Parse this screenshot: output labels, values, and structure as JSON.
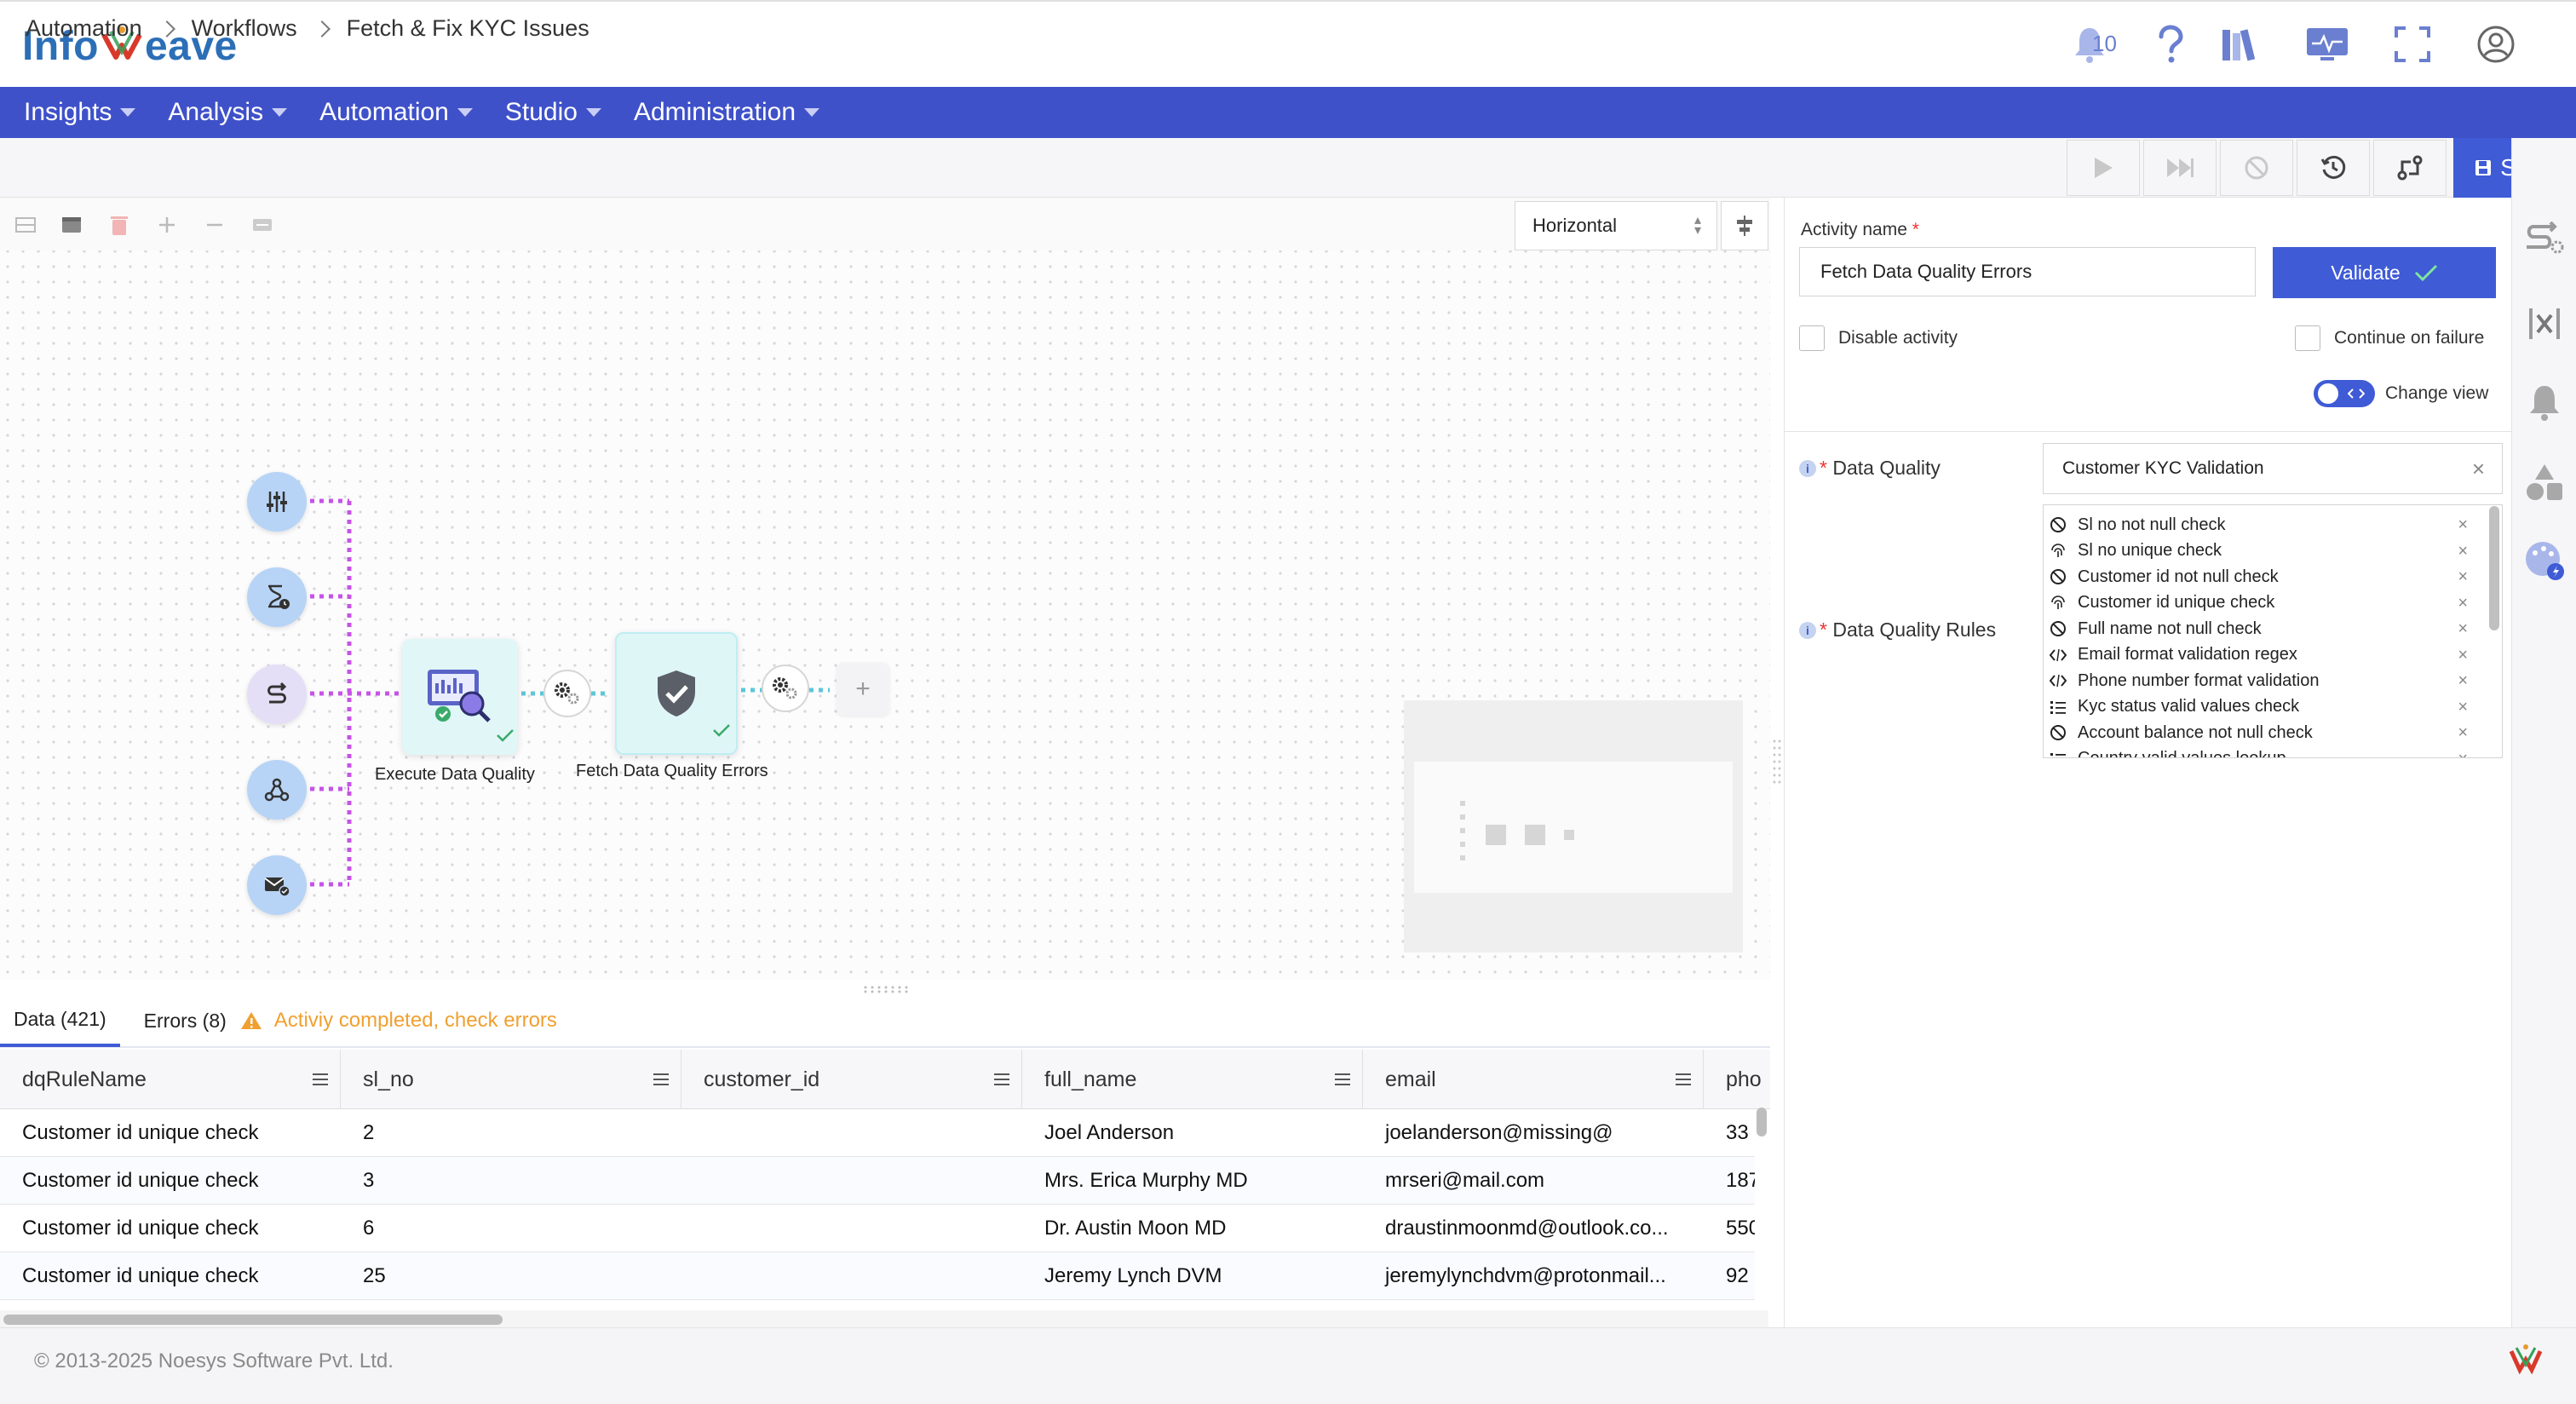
{
  "header": {
    "logo_prefix": "Info",
    "logo_suffix": "eave",
    "notification_count": "10"
  },
  "nav": {
    "items": [
      {
        "label": "Insights"
      },
      {
        "label": "Analysis"
      },
      {
        "label": "Automation"
      },
      {
        "label": "Studio"
      },
      {
        "label": "Administration"
      }
    ]
  },
  "breadcrumb": {
    "items": [
      "Automation",
      "Workflows",
      "Fetch & Fix KYC Issues"
    ]
  },
  "toolbar": {
    "save_label": "Save"
  },
  "canvas": {
    "orientation": "Horizontal",
    "nodes": [
      {
        "label": "Execute Data Quality"
      },
      {
        "label": "Fetch Data Quality Errors"
      }
    ],
    "add_symbol": "+"
  },
  "data_panel": {
    "tabs": [
      {
        "label": "Data (421)"
      },
      {
        "label": "Errors (8)"
      }
    ],
    "status_message": "Activiy completed, check errors",
    "columns": [
      "dqRuleName",
      "sl_no",
      "customer_id",
      "full_name",
      "email",
      "pho"
    ],
    "rows": [
      [
        "Customer id unique check",
        "2",
        "",
        "Joel Anderson",
        "joelanderson@missing@",
        "33"
      ],
      [
        "Customer id unique check",
        "3",
        "",
        "Mrs. Erica Murphy MD",
        "mrseri@mail.com",
        "187"
      ],
      [
        "Customer id unique check",
        "6",
        "",
        "Dr. Austin Moon MD",
        "draustinmoonmd@outlook.co...",
        "550"
      ],
      [
        "Customer id unique check",
        "25",
        "",
        "Jeremy Lynch DVM",
        "jeremylynchdvm@protonmail...",
        "92"
      ]
    ]
  },
  "properties": {
    "activity_name_label": "Activity name",
    "required_mark": "*",
    "activity_name_value": "Fetch Data Quality Errors",
    "validate_label": "Validate",
    "disable_activity_label": "Disable activity",
    "continue_on_failure_label": "Continue on failure",
    "change_view_label": "Change view",
    "data_quality_label": "Data Quality",
    "data_quality_value": "Customer KYC Validation",
    "rules_label": "Data Quality Rules",
    "rules": [
      {
        "label": "Sl no not null check",
        "icon": "null-check-icon"
      },
      {
        "label": "Sl no unique check",
        "icon": "fingerprint-icon"
      },
      {
        "label": "Customer id not null check",
        "icon": "null-check-icon"
      },
      {
        "label": "Customer id unique check",
        "icon": "fingerprint-icon"
      },
      {
        "label": "Full name not null check",
        "icon": "null-check-icon"
      },
      {
        "label": "Email format validation regex",
        "icon": "code-icon"
      },
      {
        "label": "Phone number format validation",
        "icon": "code-icon"
      },
      {
        "label": "Kyc status valid values check",
        "icon": "list-icon"
      },
      {
        "label": "Account balance not null check",
        "icon": "null-check-icon"
      },
      {
        "label": "Country valid values lookup",
        "icon": "list-icon"
      }
    ]
  },
  "footer": {
    "copyright": "© 2013-2025 Noesys Software Pvt. Ltd."
  },
  "colors": {
    "brand_blue": "#3f51c9",
    "accent": "#3f5bd6",
    "connector_purple": "#c653e6",
    "connector_teal": "#5ec6d8",
    "warning": "#f0a030"
  }
}
